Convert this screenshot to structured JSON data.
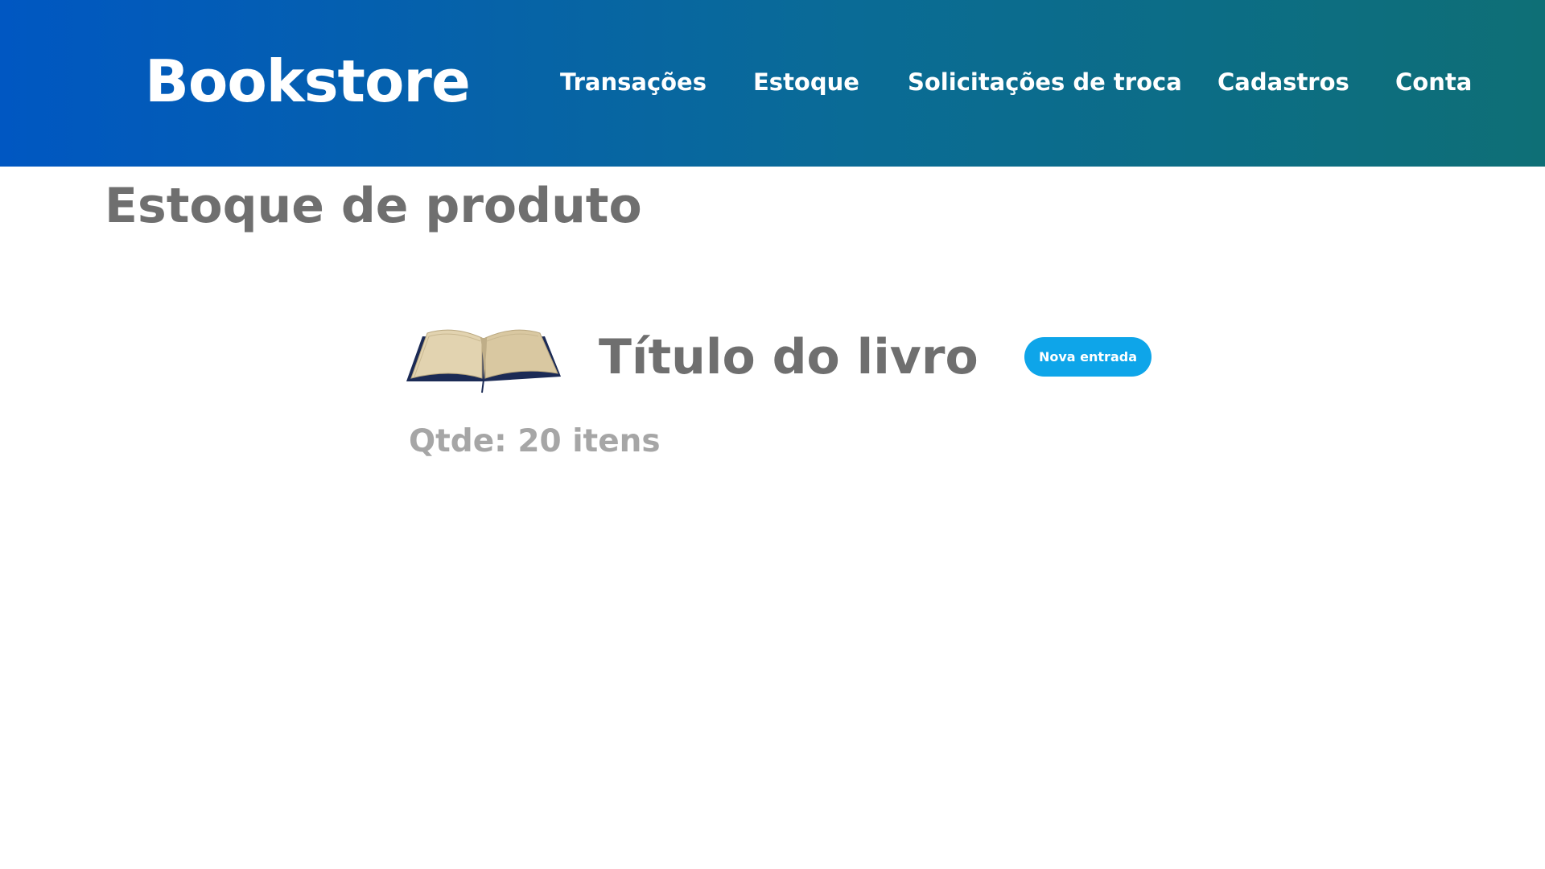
{
  "header": {
    "logo": "Bookstore",
    "nav": [
      {
        "label": "Transações"
      },
      {
        "label": "Estoque"
      },
      {
        "label": "Solicitações de troca"
      },
      {
        "label": "Cadastros"
      },
      {
        "label": "Conta"
      }
    ],
    "gradient_colors": [
      "#0057c2",
      "#0e6f76"
    ]
  },
  "main": {
    "page_title": "Estoque de produto",
    "product": {
      "image_icon": "open-book-icon",
      "title": "Título do livro",
      "new_entry_label": "Nova entrada",
      "quantity_text": "Qtde: 20 itens"
    }
  },
  "colors": {
    "accent": "#0ea5e9",
    "heading_text": "#6f6f6f",
    "muted_text": "#a6a6a6"
  }
}
